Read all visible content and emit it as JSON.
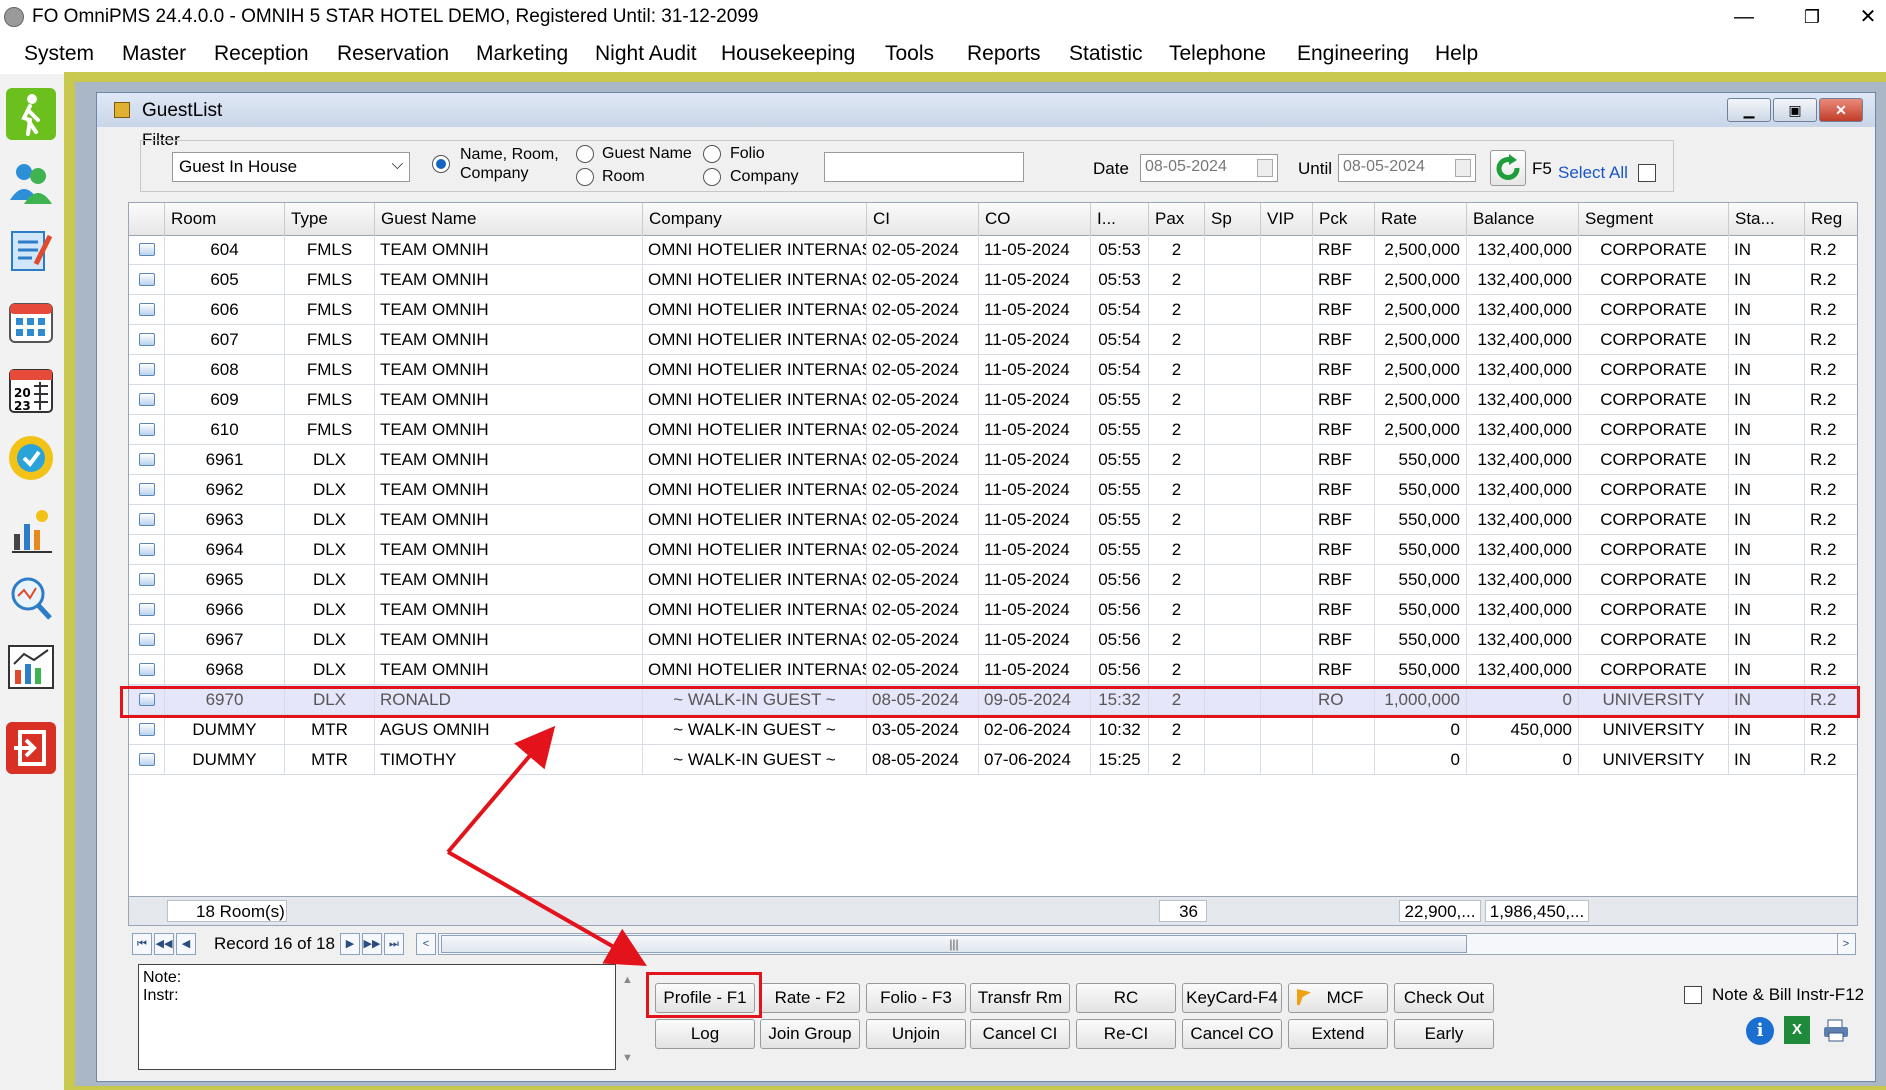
{
  "window": {
    "title": "FO OmniPMS 24.4.0.0 - OMNIH 5 STAR HOTEL DEMO, Registered Until: 31-12-2099",
    "minimize": "—",
    "restore": "❐",
    "close": "✕"
  },
  "menu": [
    "System",
    "Master",
    "Reception",
    "Reservation",
    "Marketing",
    "Night Audit",
    "Housekeeping",
    "Tools",
    "Reports",
    "Statistic",
    "Telephone",
    "Engineering",
    "Help"
  ],
  "sidebar_icons": [
    "walk-in-icon",
    "guests-icon",
    "registration-icon",
    "calendar-grid-icon",
    "calendar-2023-icon",
    "available-badge-icon",
    "night-audit-chart-icon",
    "search-analytics-icon",
    "statistics-chart-icon",
    "exit-icon"
  ],
  "guestlist": {
    "title": "GuestList",
    "filter_label": "Filter",
    "filter_value": "Guest In House",
    "radio_name_room_company": "Name, Room,\nCompany",
    "radio_guest_name": "Guest Name",
    "radio_room": "Room",
    "radio_folio": "Folio",
    "radio_company": "Company",
    "search_value": "",
    "date_label": "Date",
    "date_value": "08-05-2024",
    "until_label": "Until",
    "until_value": "08-05-2024",
    "refresh_label": "F5",
    "select_all_label": "Select All"
  },
  "columns": [
    "Room",
    "Type",
    "Guest Name",
    "Company",
    "CI",
    "CO",
    "I...",
    "Pax",
    "Sp",
    "VIP",
    "Pck",
    "Rate",
    "Balance",
    "Segment",
    "Sta...",
    "Reg"
  ],
  "rows": [
    [
      "604",
      "FMLS",
      "TEAM OMNIH",
      "OMNI HOTELIER INTERNAS...",
      "02-05-2024",
      "11-05-2024",
      "05:53",
      "2",
      "",
      "",
      "RBF",
      "2,500,000",
      "132,400,000",
      "CORPORATE",
      "IN",
      "R.2"
    ],
    [
      "605",
      "FMLS",
      "TEAM OMNIH",
      "OMNI HOTELIER INTERNAS...",
      "02-05-2024",
      "11-05-2024",
      "05:53",
      "2",
      "",
      "",
      "RBF",
      "2,500,000",
      "132,400,000",
      "CORPORATE",
      "IN",
      "R.2"
    ],
    [
      "606",
      "FMLS",
      "TEAM OMNIH",
      "OMNI HOTELIER INTERNAS...",
      "02-05-2024",
      "11-05-2024",
      "05:54",
      "2",
      "",
      "",
      "RBF",
      "2,500,000",
      "132,400,000",
      "CORPORATE",
      "IN",
      "R.2"
    ],
    [
      "607",
      "FMLS",
      "TEAM OMNIH",
      "OMNI HOTELIER INTERNAS...",
      "02-05-2024",
      "11-05-2024",
      "05:54",
      "2",
      "",
      "",
      "RBF",
      "2,500,000",
      "132,400,000",
      "CORPORATE",
      "IN",
      "R.2"
    ],
    [
      "608",
      "FMLS",
      "TEAM OMNIH",
      "OMNI HOTELIER INTERNAS...",
      "02-05-2024",
      "11-05-2024",
      "05:54",
      "2",
      "",
      "",
      "RBF",
      "2,500,000",
      "132,400,000",
      "CORPORATE",
      "IN",
      "R.2"
    ],
    [
      "609",
      "FMLS",
      "TEAM OMNIH",
      "OMNI HOTELIER INTERNAS...",
      "02-05-2024",
      "11-05-2024",
      "05:55",
      "2",
      "",
      "",
      "RBF",
      "2,500,000",
      "132,400,000",
      "CORPORATE",
      "IN",
      "R.2"
    ],
    [
      "610",
      "FMLS",
      "TEAM OMNIH",
      "OMNI HOTELIER INTERNAS...",
      "02-05-2024",
      "11-05-2024",
      "05:55",
      "2",
      "",
      "",
      "RBF",
      "2,500,000",
      "132,400,000",
      "CORPORATE",
      "IN",
      "R.2"
    ],
    [
      "6961",
      "DLX",
      "TEAM OMNIH",
      "OMNI HOTELIER INTERNAS...",
      "02-05-2024",
      "11-05-2024",
      "05:55",
      "2",
      "",
      "",
      "RBF",
      "550,000",
      "132,400,000",
      "CORPORATE",
      "IN",
      "R.2"
    ],
    [
      "6962",
      "DLX",
      "TEAM OMNIH",
      "OMNI HOTELIER INTERNAS...",
      "02-05-2024",
      "11-05-2024",
      "05:55",
      "2",
      "",
      "",
      "RBF",
      "550,000",
      "132,400,000",
      "CORPORATE",
      "IN",
      "R.2"
    ],
    [
      "6963",
      "DLX",
      "TEAM OMNIH",
      "OMNI HOTELIER INTERNAS...",
      "02-05-2024",
      "11-05-2024",
      "05:55",
      "2",
      "",
      "",
      "RBF",
      "550,000",
      "132,400,000",
      "CORPORATE",
      "IN",
      "R.2"
    ],
    [
      "6964",
      "DLX",
      "TEAM OMNIH",
      "OMNI HOTELIER INTERNAS...",
      "02-05-2024",
      "11-05-2024",
      "05:55",
      "2",
      "",
      "",
      "RBF",
      "550,000",
      "132,400,000",
      "CORPORATE",
      "IN",
      "R.2"
    ],
    [
      "6965",
      "DLX",
      "TEAM OMNIH",
      "OMNI HOTELIER INTERNAS...",
      "02-05-2024",
      "11-05-2024",
      "05:56",
      "2",
      "",
      "",
      "RBF",
      "550,000",
      "132,400,000",
      "CORPORATE",
      "IN",
      "R.2"
    ],
    [
      "6966",
      "DLX",
      "TEAM OMNIH",
      "OMNI HOTELIER INTERNAS...",
      "02-05-2024",
      "11-05-2024",
      "05:56",
      "2",
      "",
      "",
      "RBF",
      "550,000",
      "132,400,000",
      "CORPORATE",
      "IN",
      "R.2"
    ],
    [
      "6967",
      "DLX",
      "TEAM OMNIH",
      "OMNI HOTELIER INTERNAS...",
      "02-05-2024",
      "11-05-2024",
      "05:56",
      "2",
      "",
      "",
      "RBF",
      "550,000",
      "132,400,000",
      "CORPORATE",
      "IN",
      "R.2"
    ],
    [
      "6968",
      "DLX",
      "TEAM OMNIH",
      "OMNI HOTELIER INTERNAS...",
      "02-05-2024",
      "11-05-2024",
      "05:56",
      "2",
      "",
      "",
      "RBF",
      "550,000",
      "132,400,000",
      "CORPORATE",
      "IN",
      "R.2"
    ],
    [
      "6970",
      "DLX",
      "RONALD",
      "~ WALK-IN GUEST ~",
      "08-05-2024",
      "09-05-2024",
      "15:32",
      "2",
      "",
      "",
      "RO",
      "1,000,000",
      "0",
      "UNIVERSITY",
      "IN",
      "R.2"
    ],
    [
      "DUMMY",
      "MTR",
      "AGUS OMNIH",
      "~ WALK-IN GUEST ~",
      "03-05-2024",
      "02-06-2024",
      "10:32",
      "2",
      "",
      "",
      "",
      "0",
      "450,000",
      "UNIVERSITY",
      "IN",
      "R.2"
    ],
    [
      "DUMMY",
      "MTR",
      "TIMOTHY",
      "~ WALK-IN GUEST ~",
      "08-05-2024",
      "07-06-2024",
      "15:25",
      "2",
      "",
      "",
      "",
      "0",
      "0",
      "UNIVERSITY",
      "IN",
      "R.2"
    ]
  ],
  "selected_row_index": 15,
  "footer": {
    "rooms": "18 Room(s)",
    "pax": "36",
    "rate": "22,900,...",
    "balance": "1,986,450,..."
  },
  "navigator": {
    "record_text": "Record 16 of 18",
    "thumb_grip": "|||"
  },
  "note": {
    "note_label": "Note:",
    "instr_label": "Instr:"
  },
  "buttons_row1": [
    "Profile - F1",
    "Rate - F2",
    "Folio - F3",
    "Transfr Rm",
    "RC",
    "KeyCard-F4",
    "MCF",
    "Check Out"
  ],
  "buttons_row2": [
    "Log",
    "Join Group",
    "Unjoin",
    "Cancel CI",
    "Re-CI",
    "Cancel CO",
    "Extend",
    "Early"
  ],
  "note_bill_label": "Note & Bill Instr-F12",
  "colors": {
    "highlight": "#e3131b",
    "selected_row": "#e6e6fa",
    "frame": "#c8c84e"
  }
}
